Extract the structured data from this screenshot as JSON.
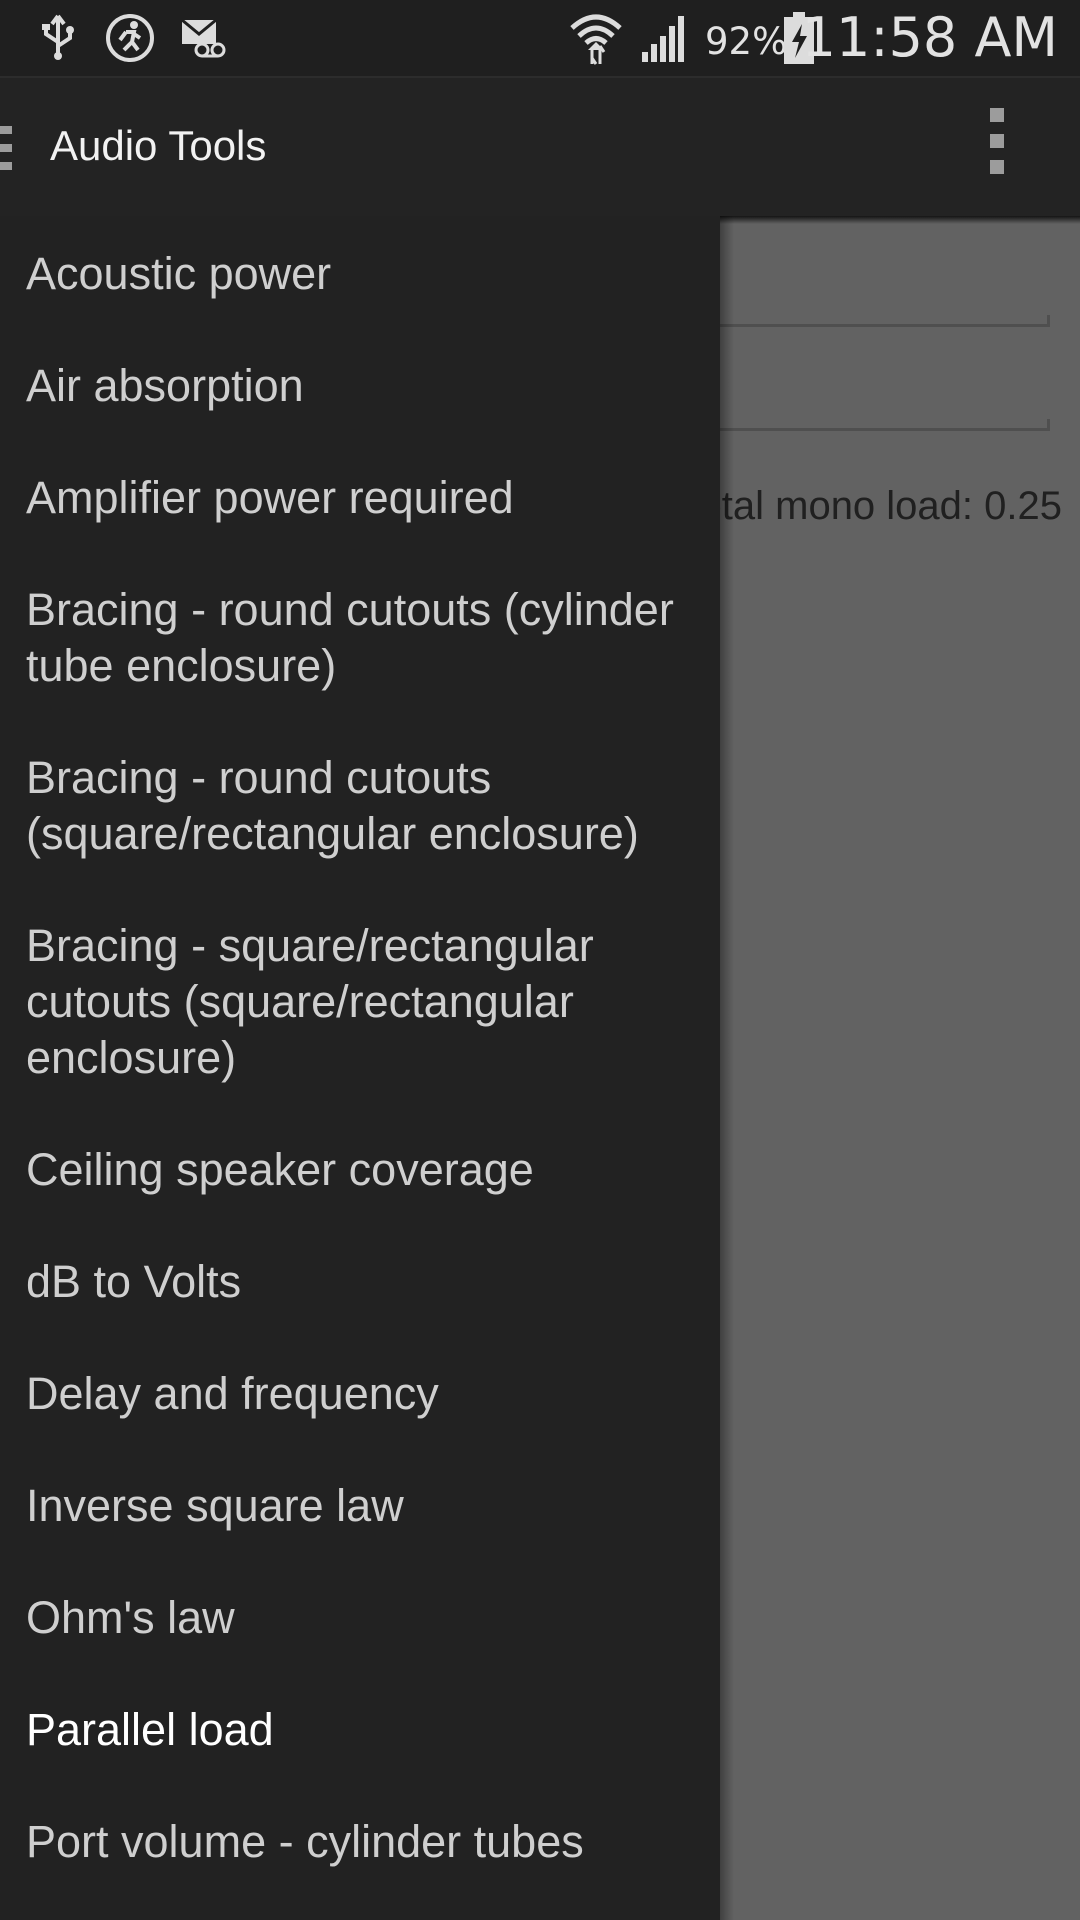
{
  "status_bar": {
    "icons_left": [
      "usb-icon",
      "running-app-icon",
      "voicemail-icon"
    ],
    "icons_right": [
      "wifi-icon",
      "signal-icon",
      "battery-charging-icon"
    ],
    "battery_percent": "92%",
    "time": "11:58 AM"
  },
  "action_bar": {
    "title": "Audio Tools",
    "left_icon": "drawer-toggle-icon",
    "right_icon": "overflow-menu-icon"
  },
  "content": {
    "result_text": "Total mono load: 0.25"
  },
  "drawer": {
    "items": [
      {
        "label": "Acoustic power",
        "active": false
      },
      {
        "label": "Air absorption",
        "active": false
      },
      {
        "label": "Amplifier power required",
        "active": false
      },
      {
        "label": "Bracing - round cutouts (cylinder tube enclosure)",
        "active": false
      },
      {
        "label": "Bracing - round cutouts (square/rectangular enclosure)",
        "active": false
      },
      {
        "label": "Bracing - square/rectangular cutouts (square/rectangular enclosure)",
        "active": false
      },
      {
        "label": "Ceiling speaker coverage",
        "active": false
      },
      {
        "label": "dB to Volts",
        "active": false
      },
      {
        "label": "Delay and frequency",
        "active": false
      },
      {
        "label": "Inverse square law",
        "active": false
      },
      {
        "label": "Ohm's law",
        "active": false
      },
      {
        "label": "Parallel load",
        "active": true
      },
      {
        "label": "Port volume - cylinder tubes",
        "active": false
      }
    ]
  },
  "colors": {
    "status_bar_bg": "#1f1f1f",
    "action_bar_bg": "#232323",
    "drawer_bg": "#222222",
    "scrim": "#626262",
    "item_text": "#cfcfcf",
    "item_text_active": "#ffffff"
  }
}
